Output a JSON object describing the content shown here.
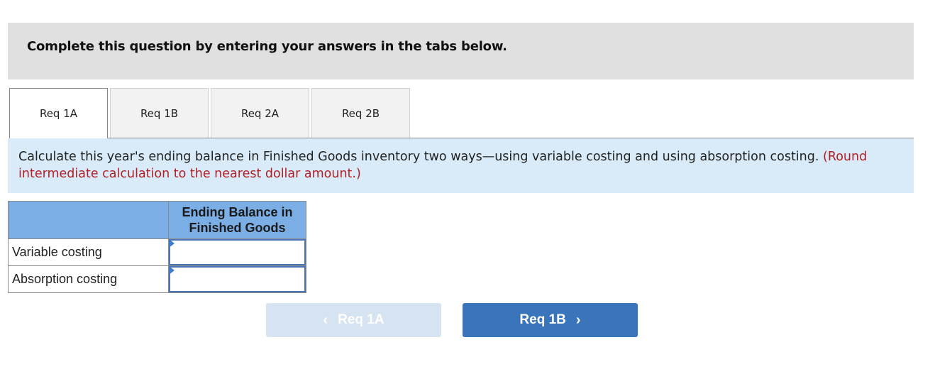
{
  "header": {
    "title": "Complete this question by entering your answers in the tabs below."
  },
  "tabs": [
    {
      "label": "Req 1A",
      "active": true
    },
    {
      "label": "Req 1B",
      "active": false
    },
    {
      "label": "Req 2A",
      "active": false
    },
    {
      "label": "Req 2B",
      "active": false
    }
  ],
  "instruction": {
    "text": "Calculate this year's ending balance in Finished Goods inventory two ways—using variable costing and using absorption costing.",
    "note": "(Round intermediate calculation to the nearest dollar amount.)"
  },
  "table": {
    "column_header": "Ending Balance in Finished Goods",
    "rows": [
      {
        "label": "Variable costing",
        "value": ""
      },
      {
        "label": "Absorption costing",
        "value": ""
      }
    ]
  },
  "navigation": {
    "prev": {
      "label": "Req 1A",
      "icon": "chevron-left-icon",
      "glyph": "‹",
      "disabled": true
    },
    "next": {
      "label": "Req 1B",
      "icon": "chevron-right-icon",
      "glyph": "›",
      "disabled": false
    }
  },
  "colors": {
    "header_bg": "#e0e0e0",
    "instruction_bg": "#d9ebf8",
    "note_red": "#b11f24",
    "table_header_bg": "#7aaee5",
    "input_border": "#4a76b8",
    "next_button": "#3a75bb",
    "prev_button_disabled": "#d6e3f1"
  }
}
